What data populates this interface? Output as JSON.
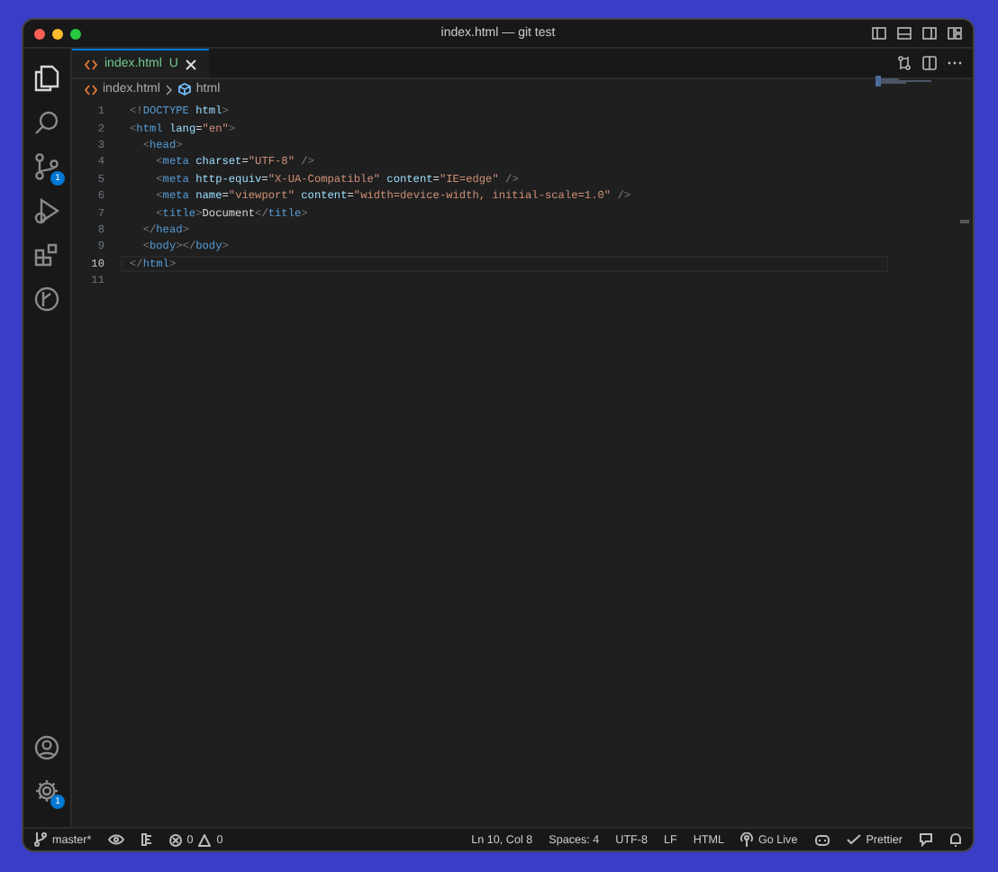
{
  "window": {
    "title": "index.html — git test"
  },
  "activity_bar": {
    "top": [
      {
        "kind": "explorer",
        "selected": true
      },
      {
        "kind": "search",
        "selected": false
      },
      {
        "kind": "scm",
        "selected": false,
        "badge": "1"
      },
      {
        "kind": "run",
        "selected": false
      },
      {
        "kind": "extensions",
        "selected": false
      },
      {
        "kind": "graph",
        "selected": false
      }
    ],
    "bottom": [
      {
        "kind": "account"
      },
      {
        "kind": "settings",
        "badge": "1"
      }
    ]
  },
  "tabs": [
    {
      "label": "index.html",
      "status": "U",
      "selected": true
    }
  ],
  "breadcrumb": [
    {
      "kind": "file",
      "label": "index.html"
    },
    {
      "kind": "element",
      "label": "html"
    }
  ],
  "editor": {
    "lines": [
      {
        "number": "1",
        "current": false,
        "tokens": [
          {
            "kind": "punct",
            "text": "<!"
          },
          {
            "kind": "tag",
            "text": "DOCTYPE"
          },
          {
            "kind": "attr",
            "text": " html"
          },
          {
            "kind": "punct",
            "text": ">"
          }
        ]
      },
      {
        "number": "2",
        "current": false,
        "tokens": [
          {
            "kind": "punct",
            "text": "<"
          },
          {
            "kind": "tag",
            "text": "html"
          },
          {
            "kind": "attr",
            "text": " lang"
          },
          {
            "kind": "text",
            "text": "="
          },
          {
            "kind": "str",
            "text": "\"en\""
          },
          {
            "kind": "punct",
            "text": ">"
          }
        ]
      },
      {
        "number": "3",
        "current": false,
        "tokens": [
          {
            "kind": "punct",
            "text": "  <"
          },
          {
            "kind": "tag",
            "text": "head"
          },
          {
            "kind": "punct",
            "text": ">"
          }
        ]
      },
      {
        "number": "4",
        "current": false,
        "tokens": [
          {
            "kind": "punct",
            "text": "    <"
          },
          {
            "kind": "tag",
            "text": "meta"
          },
          {
            "kind": "attr",
            "text": " charset"
          },
          {
            "kind": "text",
            "text": "="
          },
          {
            "kind": "str",
            "text": "\"UTF-8\""
          },
          {
            "kind": "punct",
            "text": " />"
          }
        ]
      },
      {
        "number": "5",
        "current": false,
        "tokens": [
          {
            "kind": "punct",
            "text": "    <"
          },
          {
            "kind": "tag",
            "text": "meta"
          },
          {
            "kind": "attr",
            "text": " http-equiv"
          },
          {
            "kind": "text",
            "text": "="
          },
          {
            "kind": "str",
            "text": "\"X-UA-Compatible\""
          },
          {
            "kind": "attr",
            "text": " content"
          },
          {
            "kind": "text",
            "text": "="
          },
          {
            "kind": "str",
            "text": "\"IE=edge\""
          },
          {
            "kind": "punct",
            "text": " />"
          }
        ]
      },
      {
        "number": "6",
        "current": false,
        "tokens": [
          {
            "kind": "punct",
            "text": "    <"
          },
          {
            "kind": "tag",
            "text": "meta"
          },
          {
            "kind": "attr",
            "text": " name"
          },
          {
            "kind": "text",
            "text": "="
          },
          {
            "kind": "str",
            "text": "\"viewport\""
          },
          {
            "kind": "attr",
            "text": " content"
          },
          {
            "kind": "text",
            "text": "="
          },
          {
            "kind": "str",
            "text": "\"width=device-width, initial-scale=1.0\""
          },
          {
            "kind": "punct",
            "text": " />"
          }
        ]
      },
      {
        "number": "7",
        "current": false,
        "tokens": [
          {
            "kind": "punct",
            "text": "    <"
          },
          {
            "kind": "tag",
            "text": "title"
          },
          {
            "kind": "punct",
            "text": ">"
          },
          {
            "kind": "text",
            "text": "Document"
          },
          {
            "kind": "punct",
            "text": "</"
          },
          {
            "kind": "tag",
            "text": "title"
          },
          {
            "kind": "punct",
            "text": ">"
          }
        ]
      },
      {
        "number": "8",
        "current": false,
        "tokens": [
          {
            "kind": "punct",
            "text": "  </"
          },
          {
            "kind": "tag",
            "text": "head"
          },
          {
            "kind": "punct",
            "text": ">"
          }
        ]
      },
      {
        "number": "9",
        "current": false,
        "tokens": [
          {
            "kind": "punct",
            "text": "  <"
          },
          {
            "kind": "tag",
            "text": "body"
          },
          {
            "kind": "punct",
            "text": "></"
          },
          {
            "kind": "tag",
            "text": "body"
          },
          {
            "kind": "punct",
            "text": ">"
          }
        ]
      },
      {
        "number": "10",
        "current": true,
        "tokens": [
          {
            "kind": "punct",
            "text": "</"
          },
          {
            "kind": "tag",
            "text": "html"
          },
          {
            "kind": "punct",
            "text": ">"
          }
        ]
      },
      {
        "number": "11",
        "current": false
      }
    ]
  },
  "status_bar": {
    "left": [
      {
        "kind": "branch",
        "text": "master*"
      },
      {
        "kind": "eye"
      },
      {
        "kind": "ports"
      },
      {
        "kind": "problems",
        "errors": "0",
        "warnings": "0"
      }
    ],
    "right": [
      {
        "kind": "plain",
        "text": "Ln 10, Col 8"
      },
      {
        "kind": "plain",
        "text": "Spaces: 4"
      },
      {
        "kind": "plain",
        "text": "UTF-8"
      },
      {
        "kind": "plain",
        "text": "LF"
      },
      {
        "kind": "plain",
        "text": "HTML"
      },
      {
        "kind": "live",
        "text": "Go Live"
      },
      {
        "kind": "copilot"
      },
      {
        "kind": "prettier",
        "text": "Prettier"
      },
      {
        "kind": "feedback"
      },
      {
        "kind": "bell"
      }
    ]
  }
}
